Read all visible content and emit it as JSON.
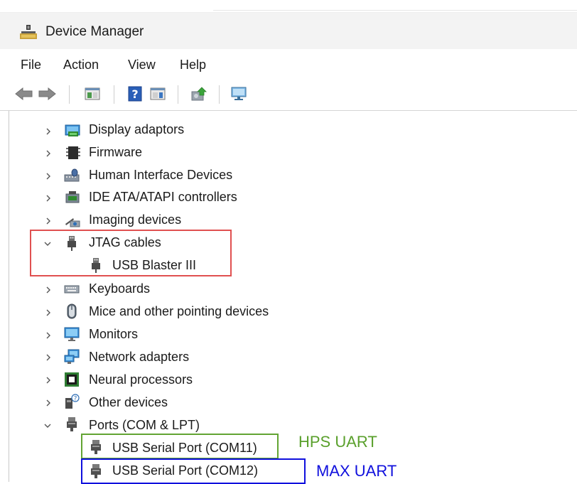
{
  "window": {
    "title": "Device Manager"
  },
  "menu": [
    "File",
    "Action",
    "View",
    "Help"
  ],
  "toolbar_icons": [
    "back-icon",
    "forward-icon",
    "show-hide-tree-icon",
    "help-icon",
    "action-pane-icon",
    "update-driver-icon",
    "scan-hardware-icon"
  ],
  "tree": {
    "items": [
      {
        "label": "Display adaptors",
        "icon": "display-adapter-icon",
        "state": "collapsed"
      },
      {
        "label": "Firmware",
        "icon": "firmware-icon",
        "state": "collapsed"
      },
      {
        "label": "Human Interface Devices",
        "icon": "hid-icon",
        "state": "collapsed"
      },
      {
        "label": "IDE ATA/ATAPI controllers",
        "icon": "ide-controller-icon",
        "state": "collapsed"
      },
      {
        "label": "Imaging devices",
        "icon": "imaging-device-icon",
        "state": "collapsed"
      },
      {
        "label": "JTAG cables",
        "icon": "usb-plug-icon",
        "state": "expanded"
      },
      {
        "label": "USB Blaster III",
        "icon": "usb-plug-icon",
        "state": "child"
      },
      {
        "label": "Keyboards",
        "icon": "keyboard-icon",
        "state": "collapsed"
      },
      {
        "label": "Mice and other pointing devices",
        "icon": "mouse-icon",
        "state": "collapsed"
      },
      {
        "label": "Monitors",
        "icon": "monitor-icon",
        "state": "collapsed"
      },
      {
        "label": "Network adapters",
        "icon": "network-adapter-icon",
        "state": "collapsed"
      },
      {
        "label": "Neural processors",
        "icon": "neural-processor-icon",
        "state": "collapsed"
      },
      {
        "label": "Other devices",
        "icon": "unknown-device-icon",
        "state": "collapsed"
      },
      {
        "label": "Ports (COM & LPT)",
        "icon": "port-icon",
        "state": "expanded"
      },
      {
        "label": "USB Serial Port (COM11)",
        "icon": "port-icon",
        "state": "child"
      },
      {
        "label": "USB Serial Port (COM12)",
        "icon": "port-icon",
        "state": "child"
      }
    ]
  },
  "annotations": {
    "hps_uart": "HPS UART",
    "max_uart": "MAX UART"
  },
  "colors": {
    "red_box": "#e05050",
    "green_box": "#62a432",
    "blue_box": "#1010dd",
    "hps_text": "#5aa02c",
    "max_text": "#1010dd"
  }
}
